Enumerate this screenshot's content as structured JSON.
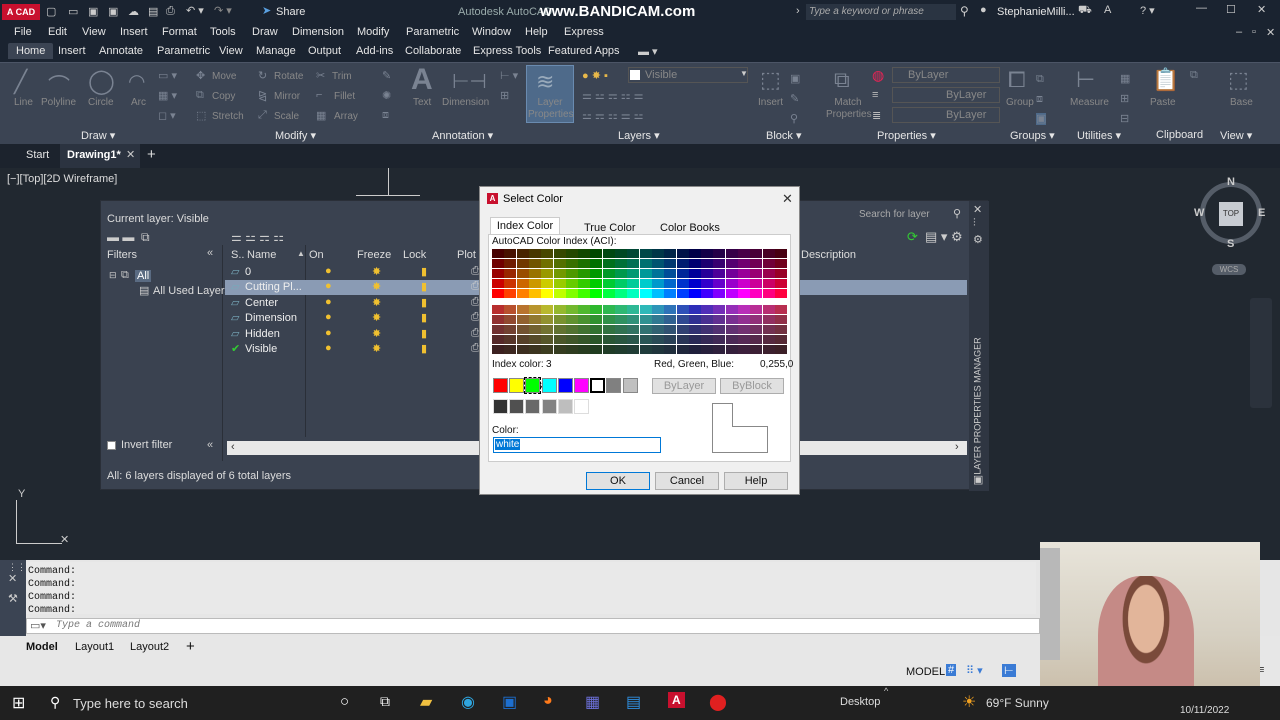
{
  "title_bar": {
    "app_logo": "A CAD",
    "share_label": "Share",
    "title": "Autodesk AutoCAD",
    "watermark": "www.BANDICAM.com",
    "search_placeholder": "Type a keyword or phrase",
    "user": "StephanieMilli..."
  },
  "menu": [
    "File",
    "Edit",
    "View",
    "Insert",
    "Format",
    "Tools",
    "Draw",
    "Dimension",
    "Modify",
    "Parametric",
    "Window",
    "Help",
    "Express"
  ],
  "ribbon_tabs": [
    "Home",
    "Insert",
    "Annotate",
    "Parametric",
    "View",
    "Manage",
    "Output",
    "Add-ins",
    "Collaborate",
    "Express Tools",
    "Featured Apps"
  ],
  "ribbon": {
    "draw": {
      "line": "Line",
      "polyline": "Polyline",
      "circle": "Circle",
      "arc": "Arc",
      "panel": "Draw ▾"
    },
    "modify": {
      "move": "Move",
      "rotate": "Rotate",
      "trim": "Trim",
      "copy": "Copy",
      "mirror": "Mirror",
      "fillet": "Fillet",
      "stretch": "Stretch",
      "scale": "Scale",
      "array": "Array",
      "panel": "Modify ▾"
    },
    "annotation": {
      "text": "Text",
      "dimension": "Dimension",
      "panel": "Annotation ▾"
    },
    "layers": {
      "layer_properties": "Layer Properties",
      "current": "Visible",
      "panel": "Layers ▾"
    },
    "block": {
      "insert": "Insert",
      "panel": "Block ▾"
    },
    "properties": {
      "match": "Match Properties",
      "bylayer1": "ByLayer",
      "bylayer2": "ByLayer",
      "bylayer3": "ByLayer",
      "panel": "Properties ▾"
    },
    "groups": {
      "group": "Group",
      "panel": "Groups ▾"
    },
    "utilities": {
      "measure": "Measure",
      "panel": "Utilities ▾"
    },
    "clipboard": {
      "paste": "Paste",
      "panel": "Clipboard"
    },
    "view": {
      "base": "Base",
      "panel": "View ▾"
    }
  },
  "file_tabs": {
    "start": "Start",
    "drawing": "Drawing1*"
  },
  "viewport_label": "[−][Top][2D Wireframe]",
  "viewcube": {
    "n": "N",
    "s": "S",
    "e": "E",
    "w": "W",
    "top": "TOP",
    "wcs": "WCS"
  },
  "layer_manager": {
    "current_layer": "Current layer: Visible",
    "search_placeholder": "Search for layer",
    "filters_label": "Filters",
    "filter_all": "All",
    "filter_used": "All Used Layers",
    "invert_filter": "Invert filter",
    "status": "All: 6 layers displayed of 6 total layers",
    "side_title": "LAYER PROPERTIES MANAGER",
    "columns": {
      "s": "S..",
      "name": "Name",
      "on": "On",
      "freeze": "Freeze",
      "lock": "Lock",
      "plot": "Plot",
      "description": "Description"
    },
    "layers": [
      {
        "name": "0",
        "current": false,
        "selected": false
      },
      {
        "name": "Cutting Pl...",
        "current": false,
        "selected": true
      },
      {
        "name": "Center",
        "current": false,
        "selected": false
      },
      {
        "name": "Dimension",
        "current": false,
        "selected": false
      },
      {
        "name": "Hidden",
        "current": false,
        "selected": false
      },
      {
        "name": "Visible",
        "current": true,
        "selected": false
      }
    ]
  },
  "dialog": {
    "title": "Select Color",
    "tabs": [
      "Index Color",
      "True Color",
      "Color Books"
    ],
    "aci_label": "AutoCAD Color Index (ACI):",
    "index_label": "Index color:",
    "index_value": "3",
    "rgb_label": "Red, Green, Blue:",
    "rgb_value": "0,255,0",
    "bylayer": "ByLayer",
    "byblock": "ByBlock",
    "color_label": "Color:",
    "color_value": "white",
    "ok": "OK",
    "cancel": "Cancel",
    "help": "Help",
    "standard_colors": [
      "#ff0000",
      "#ffff00",
      "#00ff00",
      "#00ffff",
      "#0000ff",
      "#ff00ff",
      "#ffffff",
      "#808080",
      "#c0c0c0"
    ],
    "gray_colors": [
      "#333333",
      "#505050",
      "#696969",
      "#828282",
      "#bebebe",
      "#ffffff"
    ]
  },
  "command_lines": [
    "Command:",
    "Command:",
    "Command:",
    "Command:"
  ],
  "command_placeholder": "Type a command",
  "layout_tabs": [
    "Model",
    "Layout1",
    "Layout2"
  ],
  "status_model": "MODEL",
  "taskbar": {
    "search": "Type here to search",
    "desktop": "Desktop",
    "weather": "69°F  Sunny",
    "date": "10/11/2022"
  }
}
